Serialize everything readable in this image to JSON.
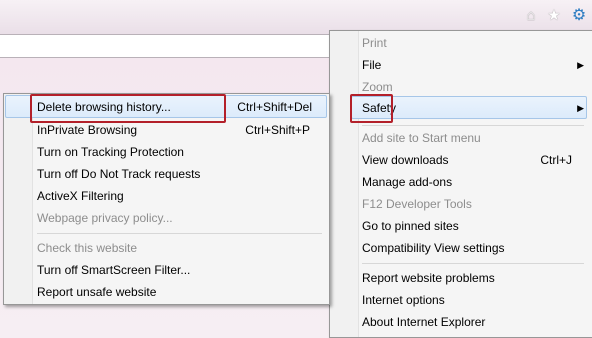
{
  "toolbar": {
    "home_icon": "home-icon",
    "favorites_icon": "star-icon",
    "tools_icon": "gear-icon"
  },
  "main_menu": {
    "items": [
      {
        "label": "Print",
        "enabled": false
      },
      {
        "label": "File",
        "enabled": true,
        "submenu": true
      },
      {
        "label": "Zoom",
        "enabled": false
      },
      {
        "label": "Safety",
        "enabled": true,
        "submenu": true,
        "highlighted": true
      },
      {
        "label": "Add site to Start menu",
        "enabled": false
      },
      {
        "label": "View downloads",
        "enabled": true,
        "shortcut": "Ctrl+J"
      },
      {
        "label": "Manage add-ons",
        "enabled": true
      },
      {
        "label": "F12 Developer Tools",
        "enabled": false
      },
      {
        "label": "Go to pinned sites",
        "enabled": true
      },
      {
        "label": "Compatibility View settings",
        "enabled": true
      },
      {
        "label": "Report website problems",
        "enabled": true
      },
      {
        "label": "Internet options",
        "enabled": true
      },
      {
        "label": "About Internet Explorer",
        "enabled": true
      }
    ]
  },
  "safety_menu": {
    "items": [
      {
        "label": "Delete browsing history...",
        "shortcut": "Ctrl+Shift+Del",
        "enabled": true,
        "highlighted": true
      },
      {
        "label": "InPrivate Browsing",
        "shortcut": "Ctrl+Shift+P",
        "enabled": true
      },
      {
        "label": "Turn on Tracking Protection",
        "enabled": true
      },
      {
        "label": "Turn off Do Not Track requests",
        "enabled": true
      },
      {
        "label": "ActiveX Filtering",
        "enabled": true
      },
      {
        "label": "Webpage privacy policy...",
        "enabled": false
      },
      {
        "label": "Check this website",
        "enabled": false
      },
      {
        "label": "Turn off SmartScreen Filter...",
        "enabled": true
      },
      {
        "label": "Report unsafe website",
        "enabled": true
      }
    ]
  },
  "colors": {
    "highlight_border": "#a6c6e8",
    "annotation_red": "#b3202a",
    "disabled_text": "#8d8d8d"
  }
}
